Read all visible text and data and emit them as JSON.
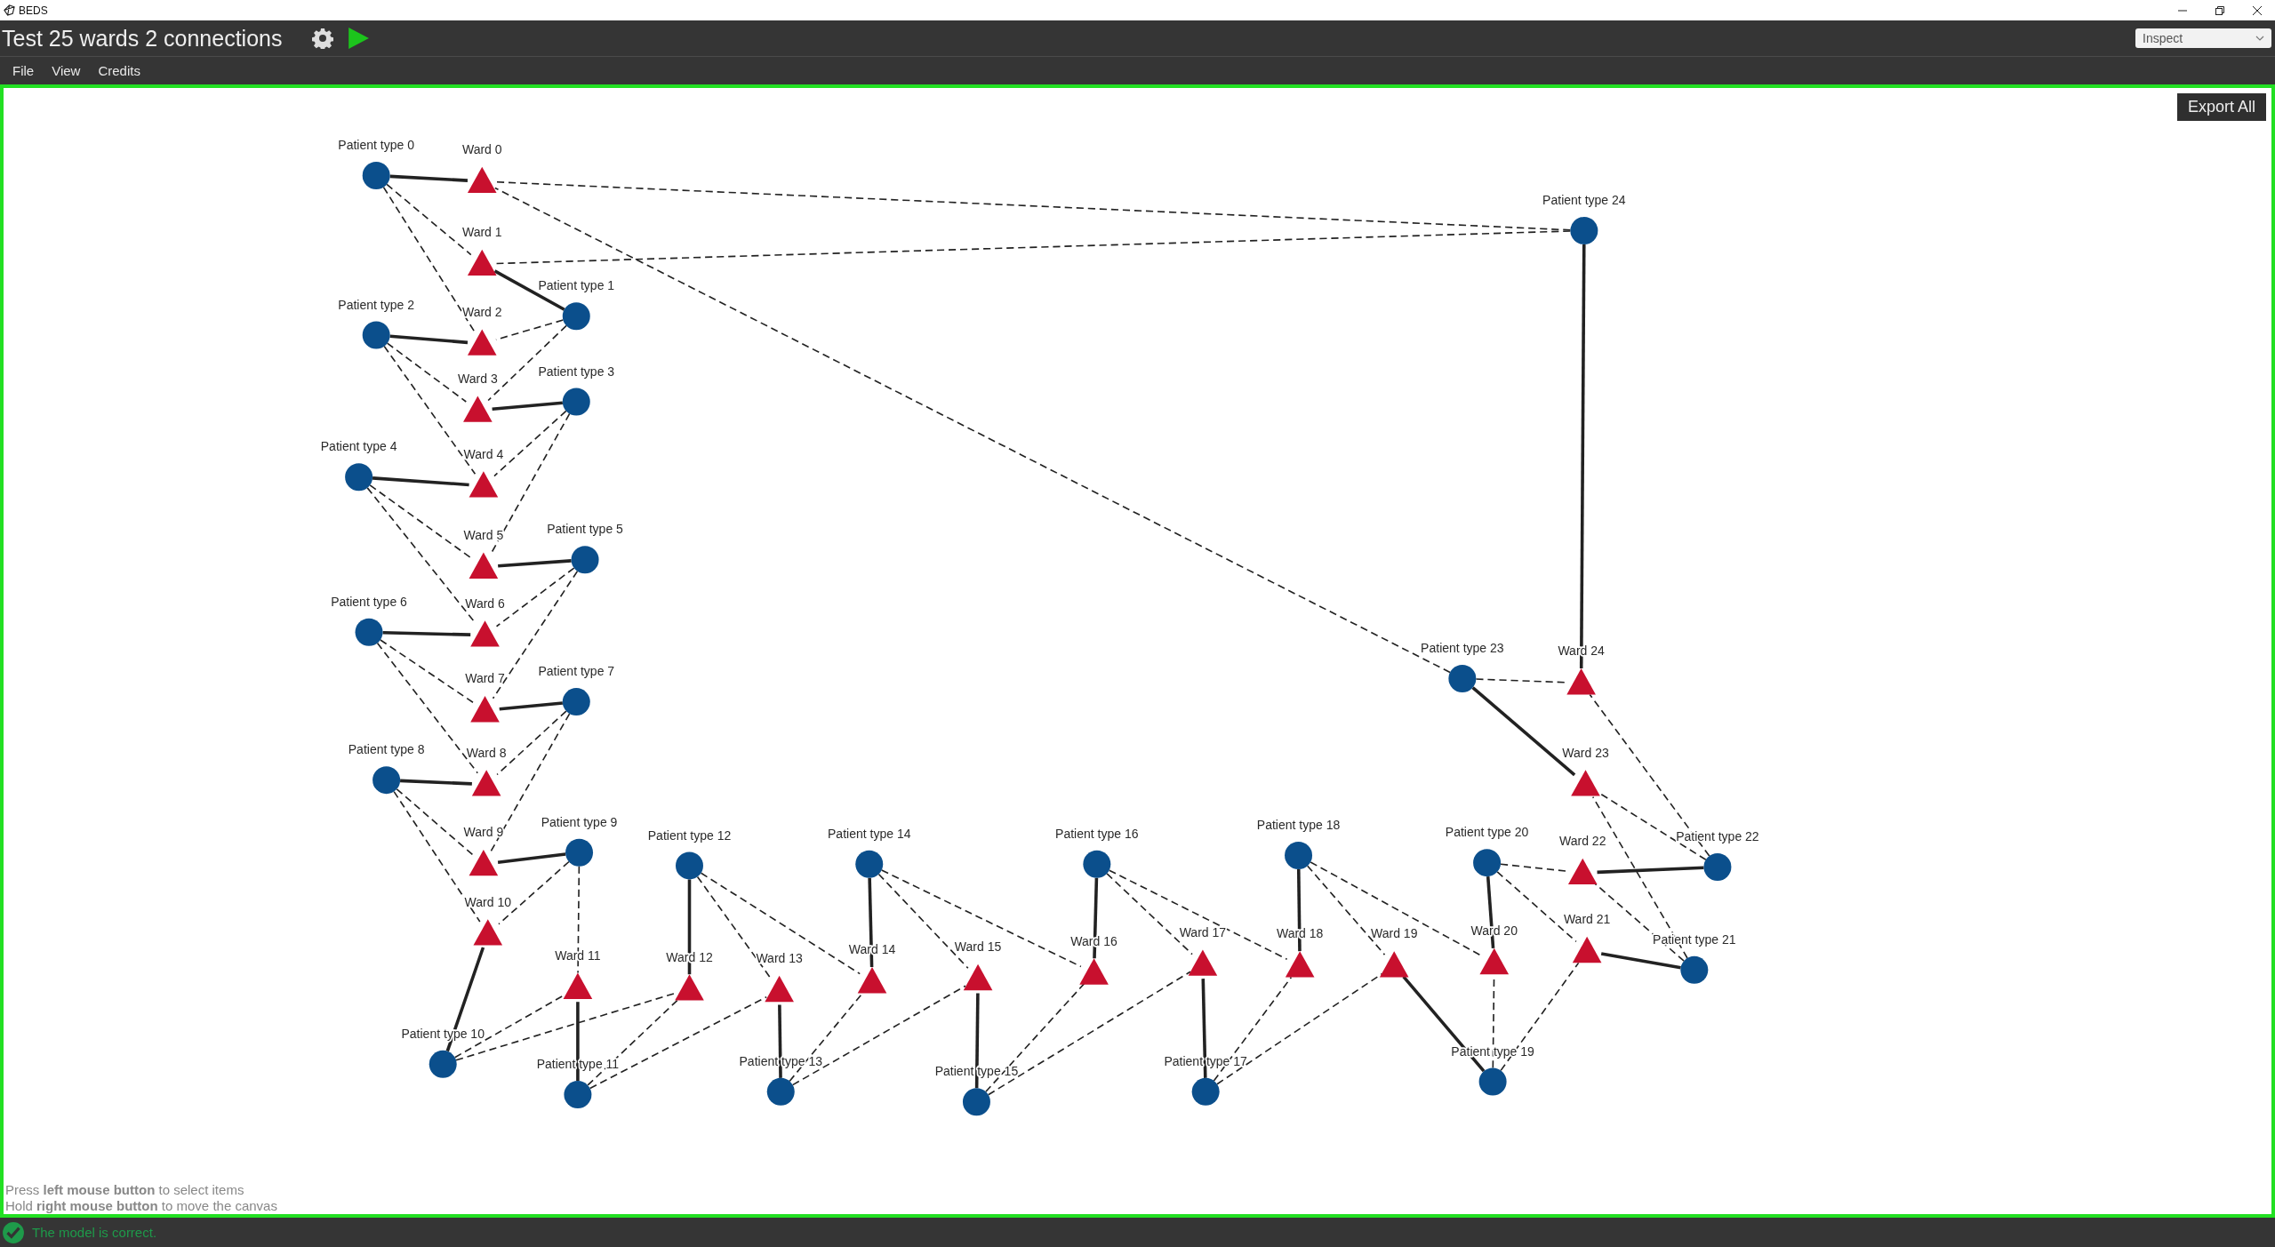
{
  "window": {
    "app_name": "BEDS",
    "title": "Test 25 wards 2 connections"
  },
  "mode_select": {
    "value": "Inspect"
  },
  "menu": [
    "File",
    "View",
    "Credits"
  ],
  "export_button": "Export All",
  "wards": [
    {
      "label": "Ward 0"
    },
    {
      "label": "Ward 1"
    },
    {
      "label": "Ward 2"
    },
    {
      "label": "Ward 3"
    },
    {
      "label": "Ward 4"
    },
    {
      "label": "Ward 5"
    },
    {
      "label": "Ward 6"
    },
    {
      "label": "Ward 7"
    },
    {
      "label": "Ward 8"
    },
    {
      "label": "Ward 9"
    },
    {
      "label": "Ward 10"
    },
    {
      "label": "Ward 11"
    },
    {
      "label": "Ward 12"
    },
    {
      "label": "Ward 13"
    },
    {
      "label": "Ward 14"
    },
    {
      "label": "Ward 15"
    },
    {
      "label": "Ward 16"
    },
    {
      "label": "Ward 17"
    },
    {
      "label": "Ward 18"
    },
    {
      "label": "Ward 19"
    },
    {
      "label": "Ward 20"
    },
    {
      "label": "Ward 24"
    },
    {
      "label": "Ward 23"
    },
    {
      "label": "Ward 22"
    },
    {
      "label": "Ward 21"
    }
  ],
  "patient_types": [
    {
      "label": "Patient type 0",
      "links": [
        {
          "kind": "solid"
        },
        {
          "kind": "dashed"
        },
        {
          "kind": "dashed"
        }
      ]
    },
    {
      "label": "Patient type 1",
      "links": [
        {
          "kind": "solid"
        },
        {
          "kind": "dashed"
        },
        {
          "kind": "dashed"
        }
      ]
    },
    {
      "label": "Patient type 2",
      "links": [
        {
          "kind": "solid"
        },
        {
          "kind": "dashed"
        },
        {
          "kind": "dashed"
        }
      ]
    },
    {
      "label": "Patient type 3",
      "links": [
        {
          "kind": "solid"
        },
        {
          "kind": "dashed"
        },
        {
          "kind": "dashed"
        }
      ]
    },
    {
      "label": "Patient type 4",
      "links": [
        {
          "kind": "solid"
        },
        {
          "kind": "dashed"
        },
        {
          "kind": "dashed"
        }
      ]
    },
    {
      "label": "Patient type 5",
      "links": [
        {
          "kind": "solid"
        },
        {
          "kind": "dashed"
        },
        {
          "kind": "dashed"
        }
      ]
    },
    {
      "label": "Patient type 6",
      "links": [
        {
          "kind": "solid"
        },
        {
          "kind": "dashed"
        },
        {
          "kind": "dashed"
        }
      ]
    },
    {
      "label": "Patient type 7",
      "links": [
        {
          "kind": "solid"
        },
        {
          "kind": "dashed"
        },
        {
          "kind": "dashed"
        }
      ]
    },
    {
      "label": "Patient type 8",
      "links": [
        {
          "kind": "solid"
        },
        {
          "kind": "dashed"
        },
        {
          "kind": "dashed"
        }
      ]
    },
    {
      "label": "Patient type 9",
      "links": [
        {
          "kind": "solid"
        },
        {
          "kind": "dashed"
        },
        {
          "kind": "dashed"
        }
      ]
    },
    {
      "label": "Patient type 10",
      "links": [
        {
          "kind": "solid"
        },
        {
          "kind": "dashed"
        },
        {
          "kind": "dashed"
        }
      ]
    },
    {
      "label": "Patient type 11",
      "links": [
        {
          "kind": "solid"
        },
        {
          "kind": "dashed"
        },
        {
          "kind": "dashed"
        }
      ]
    },
    {
      "label": "Patient type 12",
      "links": [
        {
          "kind": "solid"
        },
        {
          "kind": "dashed"
        },
        {
          "kind": "dashed"
        }
      ]
    },
    {
      "label": "Patient type 13",
      "links": [
        {
          "kind": "solid"
        },
        {
          "kind": "dashed"
        },
        {
          "kind": "dashed"
        }
      ]
    },
    {
      "label": "Patient type 14",
      "links": [
        {
          "kind": "solid"
        },
        {
          "kind": "dashed"
        },
        {
          "kind": "dashed"
        }
      ]
    },
    {
      "label": "Patient type 15",
      "links": [
        {
          "kind": "solid"
        },
        {
          "kind": "dashed"
        },
        {
          "kind": "dashed"
        }
      ]
    },
    {
      "label": "Patient type 16",
      "links": [
        {
          "kind": "solid"
        },
        {
          "kind": "dashed"
        },
        {
          "kind": "dashed"
        }
      ]
    },
    {
      "label": "Patient type 17",
      "links": [
        {
          "kind": "solid"
        },
        {
          "kind": "dashed"
        },
        {
          "kind": "dashed"
        }
      ]
    },
    {
      "label": "Patient type 18",
      "links": [
        {
          "kind": "solid"
        },
        {
          "kind": "dashed"
        },
        {
          "kind": "dashed"
        }
      ]
    },
    {
      "label": "Patient type 20",
      "links": [
        {
          "kind": "solid"
        },
        {
          "kind": "dashed"
        },
        {
          "kind": "dashed"
        }
      ]
    },
    {
      "label": "Patient type 19",
      "links": [
        {
          "kind": "solid"
        },
        {
          "kind": "dashed"
        },
        {
          "kind": "dashed"
        }
      ]
    },
    {
      "label": "Patient type 22",
      "links": [
        {
          "kind": "solid"
        },
        {
          "kind": "dashed"
        },
        {
          "kind": "dashed"
        }
      ]
    },
    {
      "label": "Patient type 21",
      "links": [
        {
          "kind": "solid"
        },
        {
          "kind": "dashed"
        },
        {
          "kind": "dashed"
        }
      ]
    },
    {
      "label": "Patient type 23",
      "links": [
        {
          "kind": "solid"
        },
        {
          "kind": "dashed"
        },
        {
          "kind": "dashed"
        }
      ]
    },
    {
      "label": "Patient type 24",
      "links": [
        {
          "kind": "solid"
        },
        {
          "kind": "dashed"
        },
        {
          "kind": "dashed"
        }
      ]
    }
  ],
  "help": [
    "Press **left mouse button** to select items",
    "Hold **right mouse button** to move the canvas"
  ],
  "status": {
    "text": "The model is correct.",
    "valid": true
  }
}
